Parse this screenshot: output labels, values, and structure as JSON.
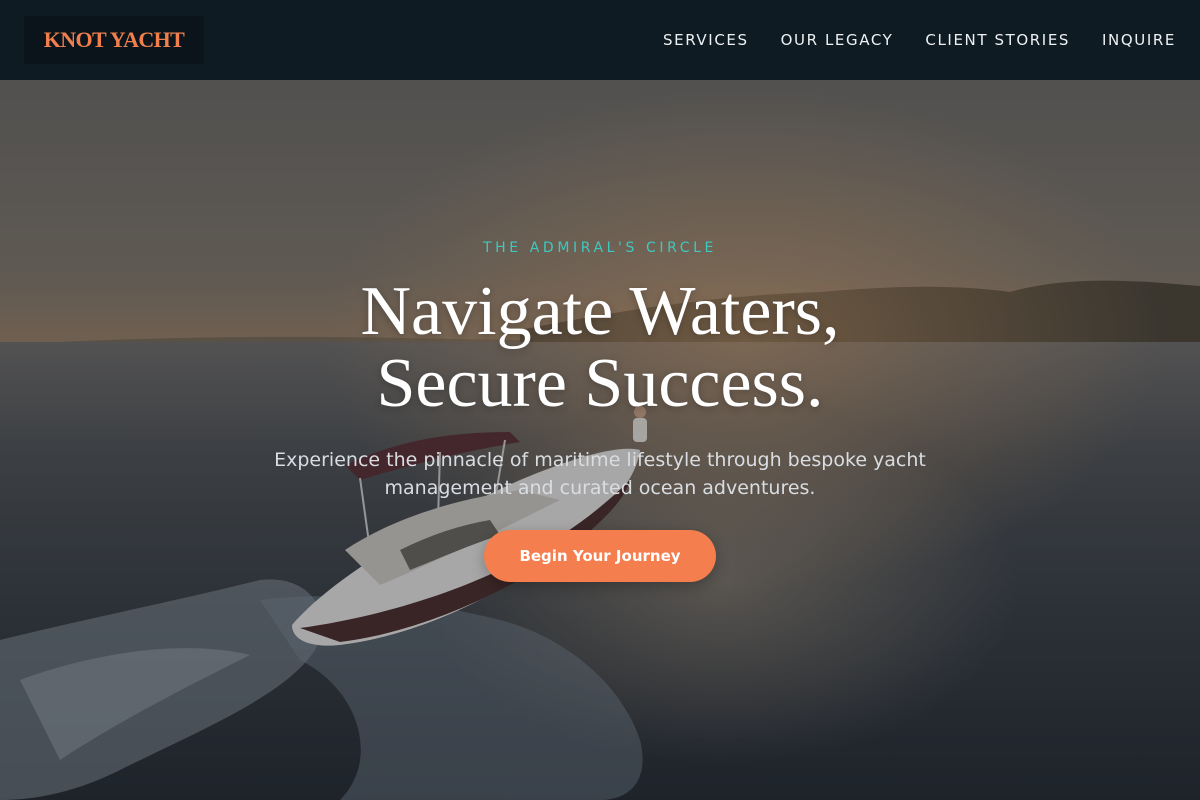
{
  "brand": {
    "logo_text": "KNOT YACHT",
    "accent_color": "#f47e4e"
  },
  "nav": {
    "items": [
      {
        "label": "SERVICES"
      },
      {
        "label": "OUR LEGACY"
      },
      {
        "label": "CLIENT STORIES"
      },
      {
        "label": "INQUIRE"
      }
    ]
  },
  "hero": {
    "eyebrow": "THE ADMIRAL'S CIRCLE",
    "eyebrow_color": "#3fc8c0",
    "headline_line1": "Navigate Waters,",
    "headline_line2": "Secure Success.",
    "subtext": "Experience the pinnacle of maritime lifestyle through bespoke yacht management and curated ocean adventures.",
    "cta_label": "Begin Your Journey",
    "background_image": "speedboat-at-sunset-photo"
  }
}
